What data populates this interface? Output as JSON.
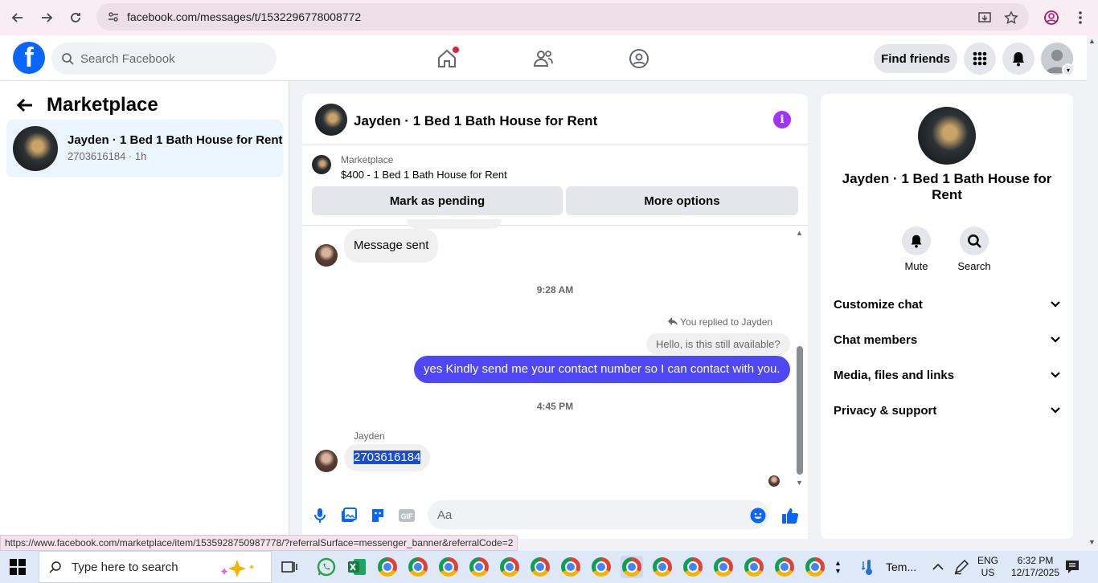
{
  "browser": {
    "url": "facebook.com/messages/t/1532296778008772"
  },
  "fb": {
    "search_placeholder": "Search Facebook",
    "find_friends": "Find friends"
  },
  "left": {
    "title": "Marketplace",
    "conversation": {
      "title": "Jayden · 1 Bed 1 Bath House for Rent",
      "subtitle": "2703616184 · 1h"
    }
  },
  "chat": {
    "title": "Jayden · 1 Bed 1 Bath House for Rent",
    "banner": {
      "label": "Marketplace",
      "item": "$400 - 1 Bed 1 Bath House for Rent",
      "mark_pending": "Mark as pending",
      "more_options": "More options"
    },
    "messages": {
      "sent_msg": "Message sent",
      "time1": "9:28 AM",
      "reply_label": "You replied to Jayden",
      "quoted": "Hello, is this still available?",
      "outgoing": "yes Kindly send me your contact number so I can contact with you.",
      "time2": "4:45 PM",
      "sender": "Jayden",
      "incoming": "2703616184"
    },
    "composer_placeholder": "Aa"
  },
  "right": {
    "name": "Jayden · 1 Bed 1 Bath House for Rent",
    "mute": "Mute",
    "search": "Search",
    "sections": [
      "Customize chat",
      "Chat members",
      "Media, files and links",
      "Privacy & support"
    ]
  },
  "status_url": "https://www.facebook.com/marketplace/item/1535928750987778/?referralSurface=messenger_banner&referralCode=2",
  "taskbar": {
    "search_placeholder": "Type here to search",
    "weather": "Tem...",
    "lang": "ENG",
    "region": "US",
    "time": "6:32 PM",
    "date": "12/17/2025"
  },
  "colors": {
    "fb_blue": "#0866ff",
    "outgoing_bubble": "#4f47f5",
    "info_purple": "#a033ff",
    "selection": "#1a4bd3"
  }
}
